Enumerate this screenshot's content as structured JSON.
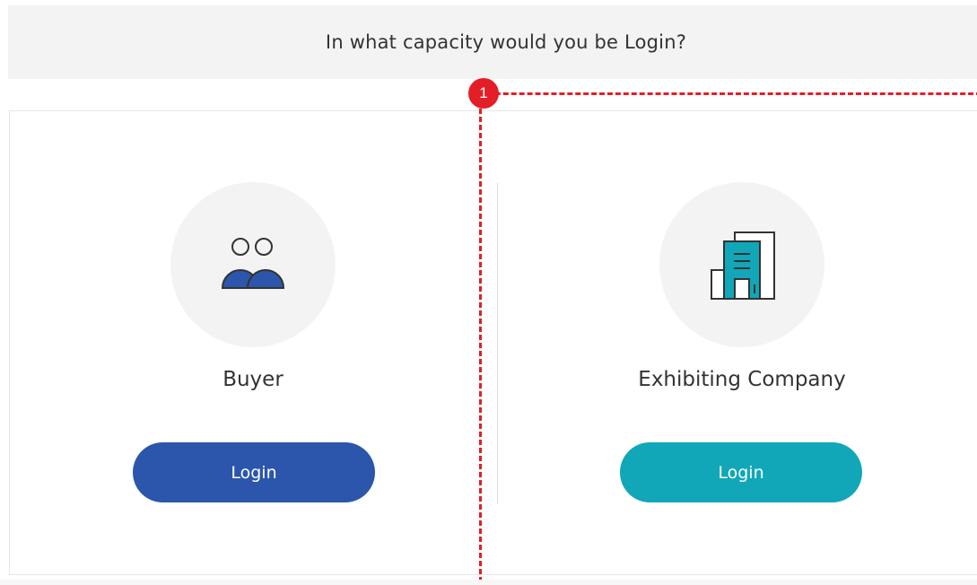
{
  "header": {
    "title": "In what capacity would you be Login?"
  },
  "options": [
    {
      "label": "Buyer",
      "button_label": "Login",
      "icon": "people-icon",
      "color": "#2b56ab"
    },
    {
      "label": "Exhibiting Company",
      "button_label": "Login",
      "icon": "building-icon",
      "color": "#11a7b9"
    }
  ],
  "annotation": {
    "marker": "1",
    "color": "#e41e26"
  }
}
